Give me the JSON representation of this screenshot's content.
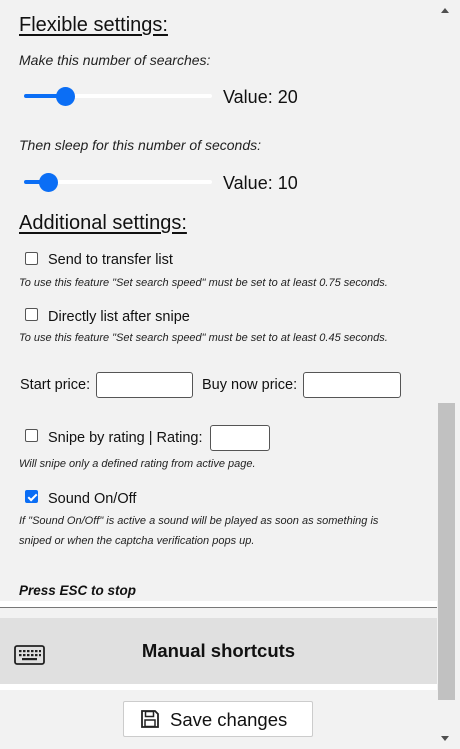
{
  "flexible": {
    "heading": "Flexible settings:",
    "searches": {
      "label": "Make this number of searches:",
      "value_text": "Value: 20",
      "value": 20,
      "fraction": 0.22
    },
    "sleep": {
      "label": "Then sleep for this number of seconds:",
      "value_text": "Value: 10",
      "value": 10,
      "fraction": 0.13
    }
  },
  "additional": {
    "heading": "Additional settings:",
    "transfer": {
      "label": "Send to transfer list",
      "checked": false,
      "note": "To use this feature \"Set search speed\" must be set to at least 0.75 seconds."
    },
    "directly": {
      "label": "Directly list after snipe",
      "checked": false,
      "note": "To use this feature \"Set search speed\" must be set to at least 0.45 seconds."
    },
    "start_price_label": "Start price:",
    "start_price_value": "",
    "buy_now_label": "Buy now price:",
    "buy_now_value": "",
    "rating": {
      "label": "Snipe by rating | Rating:",
      "checked": false,
      "value": "",
      "note": "Will snipe only a defined rating from active page."
    },
    "sound": {
      "label": "Sound On/Off",
      "checked": true,
      "note_line1": "If \"Sound On/Off\" is active a sound will be played as soon as something is",
      "note_line2": "sniped or when the captcha verification pops up."
    }
  },
  "press_esc": "Press ESC to stop",
  "shortcuts": {
    "label": "Manual shortcuts",
    "icon": "keyboard-icon"
  },
  "save": {
    "label": "Save changes",
    "icon": "floppy-disk-icon"
  },
  "colors": {
    "accent": "#0b6ef5",
    "background": "#f2f2f2",
    "bar": "#e0e0e0"
  }
}
